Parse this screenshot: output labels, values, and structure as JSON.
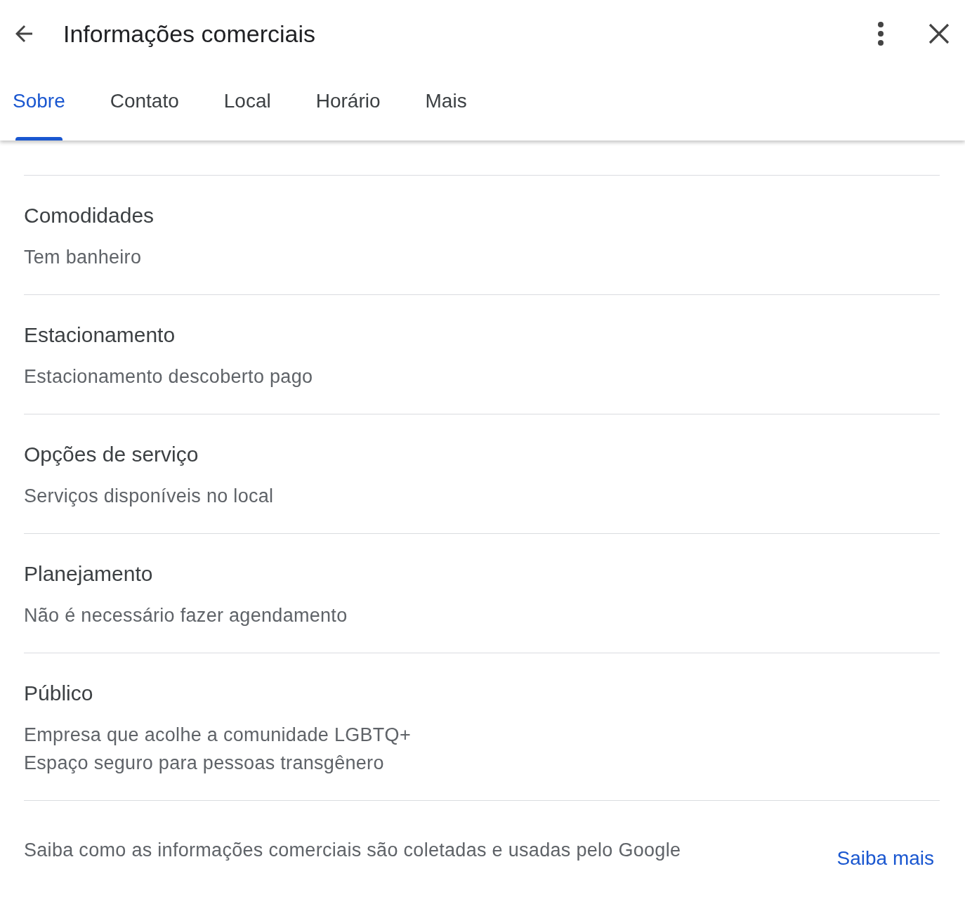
{
  "header": {
    "title": "Informações comerciais"
  },
  "tabs": [
    {
      "label": "Sobre",
      "selected": true
    },
    {
      "label": "Contato",
      "selected": false
    },
    {
      "label": "Local",
      "selected": false
    },
    {
      "label": "Horário",
      "selected": false
    },
    {
      "label": "Mais",
      "selected": false
    }
  ],
  "sections": [
    {
      "title": "Comodidades",
      "items": [
        "Tem banheiro"
      ]
    },
    {
      "title": "Estacionamento",
      "items": [
        "Estacionamento descoberto pago"
      ]
    },
    {
      "title": "Opções de serviço",
      "items": [
        "Serviços disponíveis no local"
      ]
    },
    {
      "title": "Planejamento",
      "items": [
        "Não é necessário fazer agendamento"
      ]
    },
    {
      "title": "Público",
      "items": [
        "Empresa que acolhe a comunidade LGBTQ+",
        "Espaço seguro para pessoas transgênero"
      ]
    }
  ],
  "footer": {
    "text": "Saiba como as informações comerciais são coletadas e usadas pelo Google",
    "link": "Saiba mais"
  }
}
